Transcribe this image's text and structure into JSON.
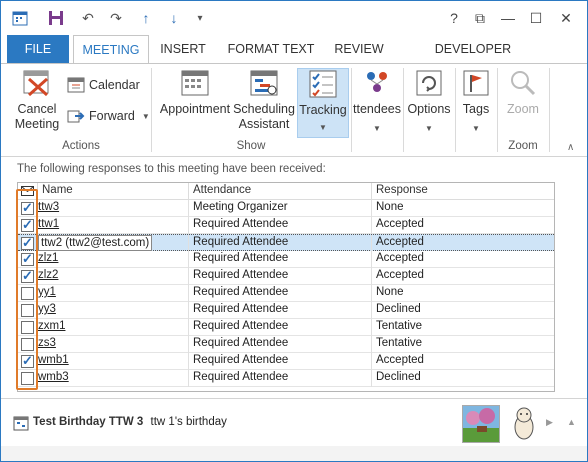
{
  "quick_access": {
    "icons": [
      "calendar-icon",
      "save-icon",
      "undo-icon",
      "redo-icon",
      "up-arrow-icon",
      "down-arrow-icon",
      "customize-icon"
    ]
  },
  "window_controls": {
    "help": "?",
    "restore": "⧉",
    "minimize": "—",
    "maximize": "☐",
    "close": "✕"
  },
  "tabs": {
    "file": "FILE",
    "meeting": "MEETING",
    "insert": "INSERT",
    "format_text": "FORMAT TEXT",
    "review": "REVIEW",
    "developer": "DEVELOPER"
  },
  "ribbon": {
    "actions": {
      "label": "Actions",
      "cancel_meeting_line1": "Cancel",
      "cancel_meeting_line2": "Meeting",
      "calendar": "Calendar",
      "forward": "Forward"
    },
    "show": {
      "label": "Show",
      "appointment": "Appointment",
      "scheduling_line1": "Scheduling",
      "scheduling_line2": "Assistant",
      "tracking": "Tracking"
    },
    "attendees": "ttendees",
    "options": "Options",
    "tags": "Tags",
    "zoom": {
      "button": "Zoom",
      "label": "Zoom"
    }
  },
  "responses": {
    "info": "The following responses to this meeting have been received:",
    "columns": {
      "name": "Name",
      "attendance": "Attendance",
      "response": "Response"
    },
    "rows": [
      {
        "checked": true,
        "name": "ttw3",
        "attendance": "Meeting Organizer",
        "response": "None"
      },
      {
        "checked": true,
        "name": "ttw1",
        "attendance": "Required Attendee",
        "response": "Accepted"
      },
      {
        "checked": true,
        "name": "ttw2 (ttw2@test.com)",
        "attendance": "Required Attendee",
        "response": "Accepted",
        "selected": true
      },
      {
        "checked": true,
        "name": "zlz1",
        "attendance": "Required Attendee",
        "response": "Accepted"
      },
      {
        "checked": true,
        "name": "zlz2",
        "attendance": "Required Attendee",
        "response": "Accepted"
      },
      {
        "checked": false,
        "name": "yy1",
        "attendance": "Required Attendee",
        "response": "None"
      },
      {
        "checked": false,
        "name": "yy3",
        "attendance": "Required Attendee",
        "response": "Declined"
      },
      {
        "checked": false,
        "name": "zxm1",
        "attendance": "Required Attendee",
        "response": "Tentative"
      },
      {
        "checked": false,
        "name": "zs3",
        "attendance": "Required Attendee",
        "response": "Tentative"
      },
      {
        "checked": true,
        "name": "wmb1",
        "attendance": "Required Attendee",
        "response": "Accepted"
      },
      {
        "checked": false,
        "name": "wmb3",
        "attendance": "Required Attendee",
        "response": "Declined"
      }
    ]
  },
  "people_pane": {
    "title": "Test Birthday TTW 3",
    "subtitle": "ttw 1's birthday"
  },
  "colors": {
    "accent": "#2b79c2",
    "highlight": "#e07b2a",
    "selection": "#cfe4f7"
  }
}
